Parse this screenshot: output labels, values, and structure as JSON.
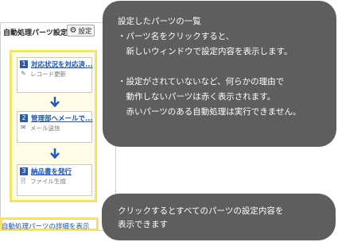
{
  "panel": {
    "title": "自動処理パーツ設定",
    "settings_label": "設定",
    "parts": [
      {
        "number": "1",
        "name": "対応状況を対応済...",
        "type": "レコード更新",
        "icon": "pencil-icon"
      },
      {
        "number": "2",
        "name": "管理部へメールで...",
        "type": "メール送信",
        "icon": "mail-icon"
      },
      {
        "number": "3",
        "name": "納品書を発行",
        "type": "ファイル生成",
        "icon": "document-icon"
      }
    ],
    "footer_link": "自動処理パーツの詳細を表示"
  },
  "callouts": {
    "top": [
      "設定したパーツの一覧",
      "・パーツ名をクリックすると、",
      "　新しいウィンドウで設定内容を表示します。",
      "",
      "・設定がされていないなど、何らかの理由で",
      "　動作しないパーツは赤く表示されます。",
      "　赤いパーツのある自動処理は実行できません。"
    ],
    "bottom": [
      "クリックするとすべてのパーツの設定内容を",
      "表示できます"
    ]
  },
  "colors": {
    "link": "#1f53b5",
    "highlight": "#f2e36b",
    "callout_bg": "#5e5e5e",
    "arrow": "#2457b8"
  }
}
